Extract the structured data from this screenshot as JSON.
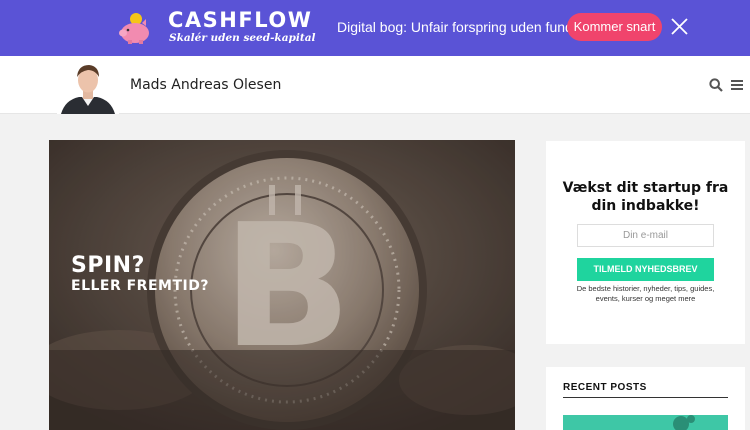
{
  "promo": {
    "brand": "CASHFLOW",
    "tagline": "Skalér uden seed-kapital",
    "text": "Digital bog: Unfair forspring uden funding",
    "cta_label": "Kommer snart",
    "bg_color": "#5a53d6",
    "cta_color": "#f0446c"
  },
  "header": {
    "author_name": "Mads Andreas Olesen"
  },
  "featured": {
    "title_line1": "SPIN?",
    "title_line2": "ELLER FREMTID?"
  },
  "newsletter": {
    "title": "Vækst dit startup fra din indbakke!",
    "email_placeholder": "Din e-mail",
    "button_label": "TILMELD NYHEDSBREV",
    "description": "De bedste historier, nyheder, tips, guides, events, kurser og meget mere",
    "button_color": "#1fd49e"
  },
  "recent_posts": {
    "title": "RECENT POSTS"
  },
  "icons": [
    "piggy-bank-icon",
    "close-icon",
    "search-icon",
    "hamburger-menu-icon"
  ]
}
